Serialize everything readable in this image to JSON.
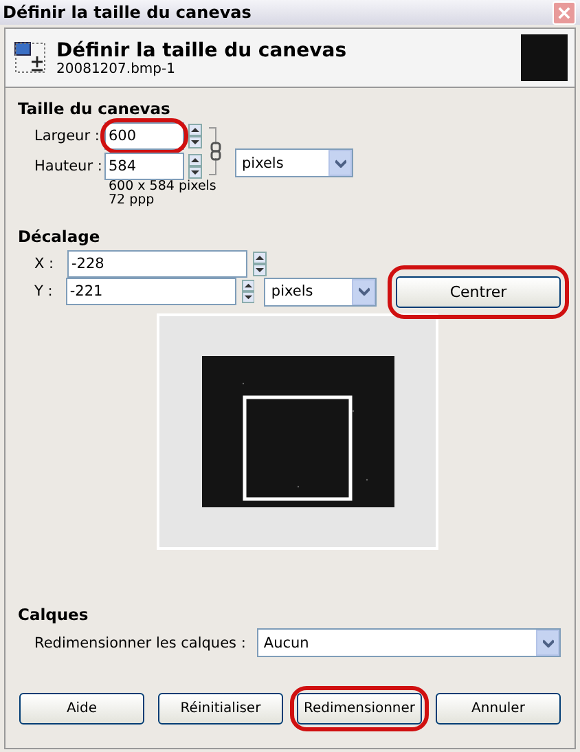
{
  "window": {
    "title": "Définir la taille du canevas"
  },
  "header": {
    "title": "Définir la taille du canevas",
    "subtitle": "20081207.bmp-1"
  },
  "canvas_size": {
    "heading": "Taille du canevas",
    "fields": [
      {
        "label": "Largeur :",
        "value": "600",
        "highlighted": true
      },
      {
        "label": "Hauteur :",
        "value": "584",
        "highlighted": false
      }
    ],
    "unit": "pixels",
    "info": [
      "600 x 584 pixels",
      "72 ppp"
    ]
  },
  "offset": {
    "heading": "Décalage",
    "fields": [
      {
        "label": "X :",
        "value": "-228"
      },
      {
        "label": "Y :",
        "value": "-221"
      }
    ],
    "unit": "pixels",
    "center_button": {
      "label": "Centrer",
      "highlighted": true
    }
  },
  "layers": {
    "heading": "Calques",
    "label": "Redimensionner les calques :",
    "value": "Aucun"
  },
  "buttons": [
    {
      "label": "Aide",
      "highlighted": false
    },
    {
      "label": "Réinitialiser",
      "highlighted": false
    },
    {
      "label": "Redimensionner",
      "highlighted": true
    },
    {
      "label": "Annuler",
      "highlighted": false
    }
  ]
}
